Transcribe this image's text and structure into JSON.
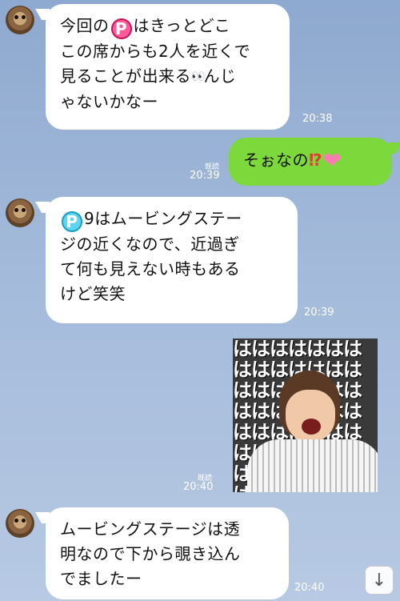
{
  "messages": [
    {
      "side": "incoming",
      "text_parts": [
        "今回の",
        "P",
        "はきっとどこ",
        "この席からも2人を近くで",
        "見ることが出来る",
        "👀",
        "んじ",
        "ゃないかなー"
      ],
      "time": "20:38"
    },
    {
      "side": "outgoing",
      "text_parts": [
        "そぉなの",
        "⁉",
        "❤"
      ],
      "read_label": "既読",
      "time": "20:39"
    },
    {
      "side": "incoming",
      "text_parts": [
        "P",
        "9はムービングステー",
        "ジの近くなので、近過ぎ",
        "て何も見えない時もある",
        "けど笑笑"
      ],
      "time": "20:39"
    },
    {
      "side": "outgoing",
      "type": "image",
      "image_text": "はははははははははははははははははははははははははははははははははははははははははははははははははははははははははははははははははははははははははははははははは",
      "read_label": "既読",
      "time": "20:40"
    },
    {
      "side": "incoming",
      "text_parts": [
        "ムービングステージは透",
        "明なので下から覗き込ん",
        "でましたー"
      ],
      "time": "20:40"
    }
  ],
  "controls": {
    "scroll_down_icon": "arrow-down-icon",
    "scroll_down_glyph": "↓"
  },
  "colors": {
    "outgoing_bubble": "#7dd93b",
    "incoming_bubble": "#ffffff",
    "background": "#a3bada"
  }
}
